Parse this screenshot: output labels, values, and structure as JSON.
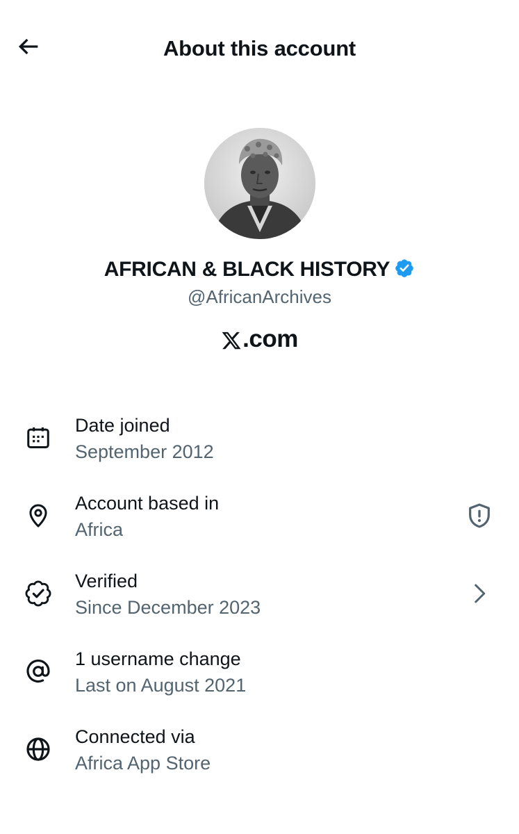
{
  "header": {
    "title": "About this account",
    "back_icon": "arrow-left-icon"
  },
  "profile": {
    "display_name": "AFRICAN & BLACK HISTORY",
    "handle": "@AfricanArchives",
    "verified_badge_color": "#1d9bf0",
    "site_label": ".com",
    "site_logo": "x-logo-icon"
  },
  "details": [
    {
      "icon": "calendar-icon",
      "label": "Date joined",
      "value": "September 2012"
    },
    {
      "icon": "location-pin-icon",
      "label": "Account based in",
      "value": "Africa",
      "trailing_icon": "shield-alert-icon"
    },
    {
      "icon": "verified-badge-icon",
      "label": "Verified",
      "value": "Since December 2023",
      "trailing_icon": "chevron-right-icon"
    },
    {
      "icon": "at-sign-icon",
      "label": "1 username change",
      "value": "Last on August 2021"
    },
    {
      "icon": "globe-icon",
      "label": "Connected via",
      "value": "Africa App Store"
    }
  ],
  "colors": {
    "text_primary": "#0f1419",
    "text_secondary": "#536471",
    "accent": "#1d9bf0",
    "background": "#ffffff"
  }
}
